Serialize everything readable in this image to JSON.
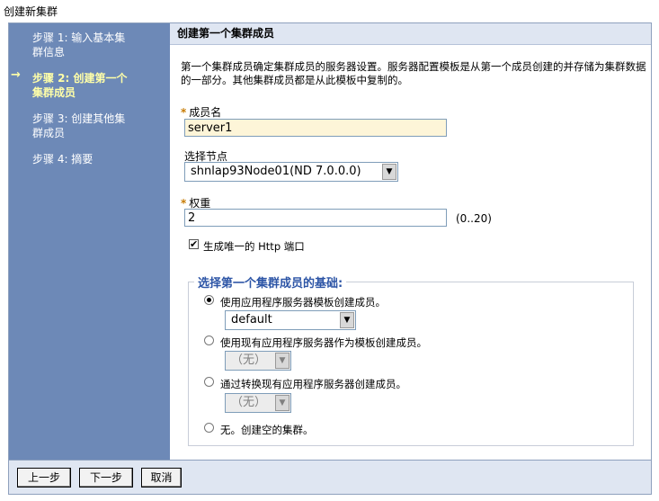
{
  "window": {
    "title": "创建新集群"
  },
  "steps": [
    {
      "label": "步骤 1: 输入基本集群信息",
      "line1": "步骤 1: 输入基本集",
      "line2": "群信息"
    },
    {
      "label": "步骤 2: 创建第一个集群成员",
      "line1": "步骤 2: 创建第一个",
      "line2": "集群成员",
      "current": true,
      "marker": "→"
    },
    {
      "label": "步骤 3: 创建其他集群成员",
      "line1": "步骤 3: 创建其他集",
      "line2": "群成员"
    },
    {
      "label": "步骤 4: 摘要",
      "line1": "步骤 4: 摘要"
    }
  ],
  "main": {
    "header": "创建第一个集群成员",
    "description": "第一个集群成员确定集群成员的服务器设置。服务器配置模板是从第一个成员创建的并存储为集群数据的一部分。其他集群成员都是从此模板中复制的。",
    "required_marker": "*",
    "member_name": {
      "label": "成员名",
      "value": "server1"
    },
    "select_node": {
      "label": "选择节点",
      "value": "shnlap93Node01(ND 7.0.0.0)"
    },
    "weight": {
      "label": "权重",
      "value": "2",
      "range": "(0..20)"
    },
    "unique_http_port": {
      "label": "生成唯一的 Http 端口",
      "checked": true,
      "check_glyph": "✔"
    },
    "basis": {
      "legend": "选择第一个集群成员的基础:",
      "options": [
        {
          "label": "使用应用程序服务器模板创建成员。",
          "selected": true,
          "select_value": "default"
        },
        {
          "label": "使用现有应用程序服务器作为模板创建成员。",
          "selected": false,
          "select_value": "（无）"
        },
        {
          "label": "通过转换现有应用程序服务器创建成员。",
          "selected": false,
          "select_value": "（无）"
        },
        {
          "label": "无。创建空的集群。",
          "selected": false
        }
      ]
    }
  },
  "footer": {
    "prev": "上一步",
    "next": "下一步",
    "cancel": "取消"
  },
  "icons": {
    "dropdown": "▼"
  },
  "colors": {
    "sidebar": "#6d89b7",
    "header": "#dfe6f2",
    "legend": "#2d55a6",
    "current_step": "#ffffa8"
  }
}
